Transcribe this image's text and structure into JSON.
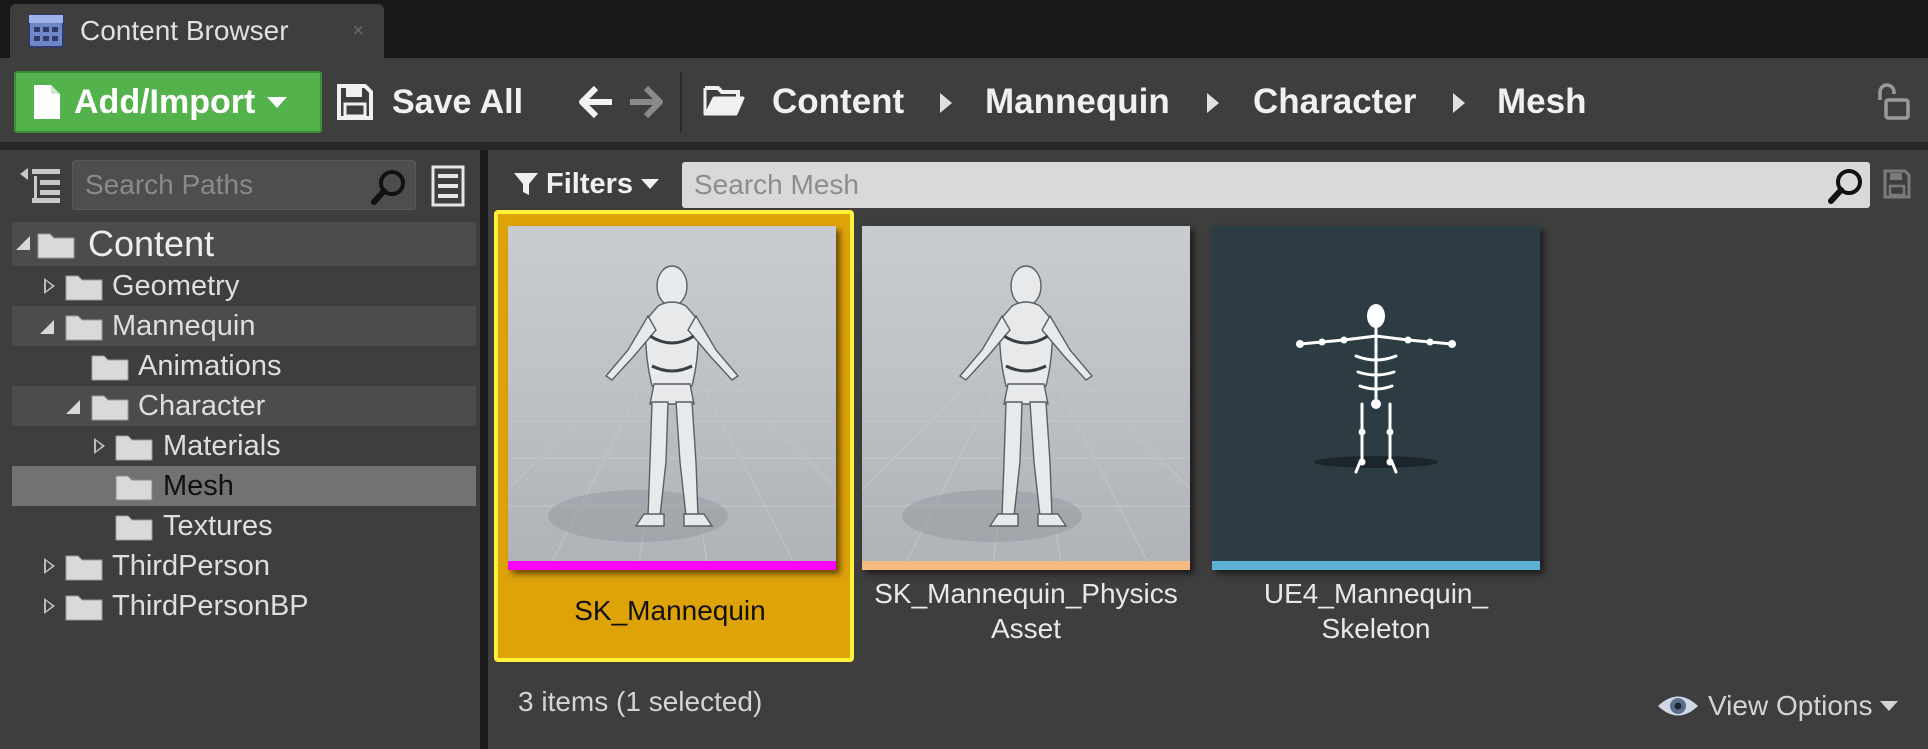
{
  "tab": {
    "title": "Content Browser",
    "close": "×",
    "icon": "content-browser-grid-icon"
  },
  "toolbar": {
    "add_import_label": "Add/Import",
    "save_all_label": "Save All",
    "back_icon": "arrow-left-icon",
    "forward_icon": "arrow-right-icon",
    "breadcrumb": [
      "Content",
      "Mannequin",
      "Character",
      "Mesh"
    ],
    "lock_icon": "unlocked-padlock-icon"
  },
  "sources": {
    "search_placeholder": "Search Paths",
    "tree": [
      {
        "label": "Content",
        "expander": "open",
        "state": "highlighted"
      },
      {
        "label": "Geometry",
        "expander": "closed",
        "state": "normal"
      },
      {
        "label": "Mannequin",
        "expander": "open",
        "state": "highlighted"
      },
      {
        "label": "Animations",
        "expander": "none",
        "state": "normal"
      },
      {
        "label": "Character",
        "expander": "open",
        "state": "highlighted"
      },
      {
        "label": "Materials",
        "expander": "closed",
        "state": "normal"
      },
      {
        "label": "Mesh",
        "expander": "none",
        "state": "selected"
      },
      {
        "label": "Textures",
        "expander": "none",
        "state": "normal"
      },
      {
        "label": "ThirdPerson",
        "expander": "closed",
        "state": "normal"
      },
      {
        "label": "ThirdPersonBP",
        "expander": "closed",
        "state": "normal"
      }
    ]
  },
  "assets": {
    "filters_label": "Filters",
    "search_placeholder": "Search Mesh",
    "items": [
      {
        "name": "SK_Mannequin",
        "type_color": "#ff00ff",
        "selected": true,
        "thumbnail": "mannequin-figure"
      },
      {
        "name_line1": "SK_Mannequin_Physics",
        "name_line2": "Asset",
        "type_color": "#f5b984",
        "selected": false,
        "thumbnail": "mannequin-figure"
      },
      {
        "name_line1": "UE4_Mannequin_",
        "name_line2": "Skeleton",
        "type_color": "#5fb1d3",
        "selected": false,
        "thumbnail": "skeleton-figure"
      }
    ],
    "status_text": "3 items (1 selected)",
    "view_options_label": "View Options"
  },
  "colors": {
    "add_import_green": "#54b24c",
    "selection_fill": "#dfa30a",
    "selection_border": "#fff23a",
    "panel_bg": "#3e3e3e",
    "search_field_bg": "#d9d9d9"
  }
}
